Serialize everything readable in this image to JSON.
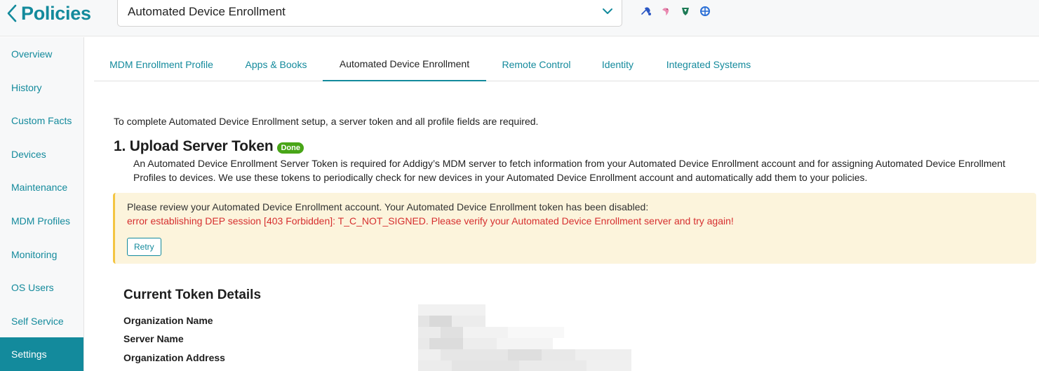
{
  "header": {
    "back_title": "Policies",
    "policy_select_value": "Automated Device Enrollment",
    "status_icons": [
      {
        "name": "blue-tools-icon",
        "color": "#2b57c4"
      },
      {
        "name": "pink-bird-icon",
        "color": "#e98ab1"
      },
      {
        "name": "green-shield-icon",
        "color": "#1d7a56"
      },
      {
        "name": "blue-globe-icon",
        "color": "#2b6fd6"
      }
    ]
  },
  "sidebar": {
    "items": [
      {
        "label": "Overview",
        "active": false
      },
      {
        "label": "History",
        "active": false
      },
      {
        "label": "Custom Facts",
        "active": false
      },
      {
        "label": "Devices",
        "active": false
      },
      {
        "label": "Maintenance",
        "active": false
      },
      {
        "label": "MDM Profiles",
        "active": false
      },
      {
        "label": "Monitoring",
        "active": false
      },
      {
        "label": "OS Users",
        "active": false
      },
      {
        "label": "Self Service",
        "active": false
      },
      {
        "label": "Settings",
        "active": true
      }
    ]
  },
  "tabs": [
    {
      "label": "MDM Enrollment Profile",
      "active": false
    },
    {
      "label": "Apps & Books",
      "active": false
    },
    {
      "label": "Automated Device Enrollment",
      "active": true
    },
    {
      "label": "Remote Control",
      "active": false
    },
    {
      "label": "Identity",
      "active": false
    },
    {
      "label": "Integrated Systems",
      "active": false
    }
  ],
  "main": {
    "intro": "To complete Automated Device Enrollment setup, a server token and all profile fields are required.",
    "section_title": "1. Upload Server Token",
    "section_badge": "Done",
    "description": "An Automated Device Enrollment Server Token is required for Addigy’s MDM server to fetch information from your Automated Device Enrollment account and for assigning Automated Device Enrollment Profiles to devices. We use these tokens to periodically check for new devices in your Automated Device Enrollment account and automatically add them to your policies.",
    "alert": {
      "message": "Please review your Automated Device Enrollment account. Your Automated Device Enrollment token has been disabled:",
      "error": "error establishing DEP session [403 Forbidden]: T_C_NOT_SIGNED. Please verify your Automated Device Enrollment server and try again!",
      "retry_label": "Retry"
    },
    "token_details": {
      "title": "Current Token Details",
      "labels": [
        "Organization Name",
        "Server Name",
        "Organization Address"
      ]
    }
  },
  "colors": {
    "accent": "#138a9c",
    "alert_bg": "#fcf4dc",
    "alert_border": "#f4c542",
    "error_text": "#d62f2f",
    "badge_green": "#48a517"
  }
}
